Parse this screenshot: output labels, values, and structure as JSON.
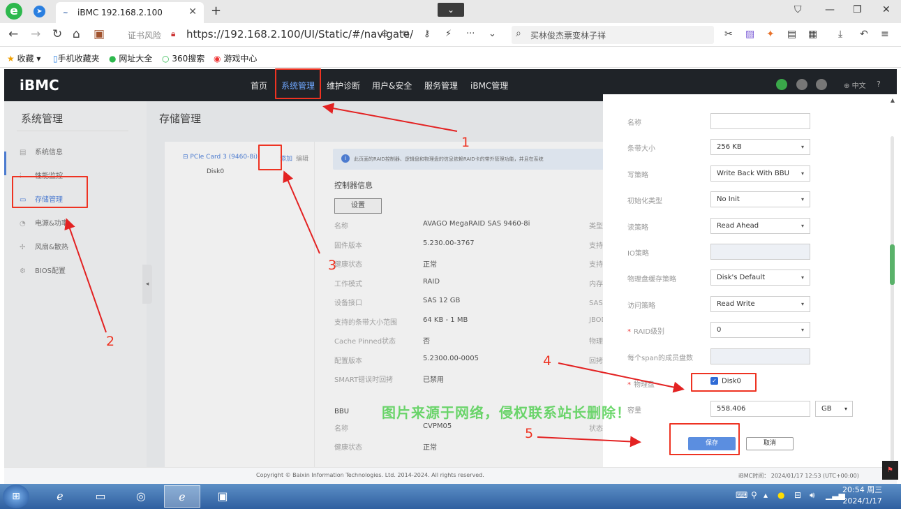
{
  "browser": {
    "tab_title": "iBMC 192.168.2.100",
    "favicon_text": "~",
    "cert_warning": "证书风险",
    "url": "https://192.168.2.100/UI/Static/#/navigate/",
    "search_text": "买林俊杰票变林子祥",
    "bookmarks": [
      "收藏",
      "手机收藏夹",
      "网址大全",
      "360搜索",
      "游戏中心"
    ]
  },
  "app": {
    "brand": "iBMC",
    "menu": [
      "首页",
      "系统管理",
      "维护诊断",
      "用户&安全",
      "服务管理",
      "iBMC管理"
    ],
    "lang": "中文"
  },
  "sidebar": {
    "title": "系统管理",
    "items": [
      {
        "label": "系统信息",
        "icon": "info-icon"
      },
      {
        "label": "性能监控",
        "icon": "chart-icon"
      },
      {
        "label": "存储管理",
        "icon": "storage-icon"
      },
      {
        "label": "电源&功率",
        "icon": "power-icon"
      },
      {
        "label": "风扇&散热",
        "icon": "fan-icon"
      },
      {
        "label": "BIOS配置",
        "icon": "gear-icon"
      }
    ]
  },
  "content": {
    "title": "存储管理",
    "tree_card": "PCIe Card 3 (9460-8i)",
    "tree_disk": "Disk0",
    "add": "添加",
    "edit": "编辑",
    "info_notice": "此页面的RAID控制器、逻辑盘和物理盘的信息依赖RAID卡的带外管理功能，并且在系统",
    "controller_title": "控制器信息",
    "settings_button": "设置",
    "controller": [
      {
        "k": "名称",
        "v": "AVAGO MegaRAID SAS 9460-8i",
        "r": "类型"
      },
      {
        "k": "固件版本",
        "v": "5.230.00-3767",
        "r": "支持"
      },
      {
        "k": "健康状态",
        "v": "正常",
        "r": "支持"
      },
      {
        "k": "工作模式",
        "v": "RAID",
        "r": "内存"
      },
      {
        "k": "设备接口",
        "v": "SAS 12 GB",
        "r": "SAS地"
      },
      {
        "k": "支持的条带大小范围",
        "v": "64 KB - 1 MB",
        "r": "JBOD"
      },
      {
        "k": "Cache Pinned状态",
        "v": "否",
        "r": "物理盘"
      },
      {
        "k": "配置版本",
        "v": "5.2300.00-0005",
        "r": "回拷"
      },
      {
        "k": "SMART错误时回拷",
        "v": "已禁用",
        "r": ""
      }
    ],
    "bbu_title": "BBU",
    "bbu": [
      {
        "k": "名称",
        "v": "CVPM05",
        "r": "状态"
      },
      {
        "k": "健康状态",
        "v": "正常",
        "r": ""
      }
    ]
  },
  "drawer": {
    "fields": [
      {
        "label": "名称",
        "value": "",
        "type": "input",
        "required": false
      },
      {
        "label": "条带大小",
        "value": "256 KB",
        "type": "select",
        "required": false
      },
      {
        "label": "写策略",
        "value": "Write Back With BBU",
        "type": "select",
        "required": false
      },
      {
        "label": "初始化类型",
        "value": "No Init",
        "type": "select",
        "required": false
      },
      {
        "label": "读策略",
        "value": "Read Ahead",
        "type": "select",
        "required": false
      },
      {
        "label": "IO策略",
        "value": "",
        "type": "disabled",
        "required": false
      },
      {
        "label": "物理盘缓存策略",
        "value": "Disk's Default",
        "type": "select",
        "required": false
      },
      {
        "label": "访问策略",
        "value": "Read Write",
        "type": "select",
        "required": false
      },
      {
        "label": "RAID级别",
        "value": "0",
        "type": "select",
        "required": true
      },
      {
        "label": "每个span的成员盘数",
        "value": "",
        "type": "disabled",
        "required": false
      }
    ],
    "physical_disk_label": "物理盘",
    "physical_disk": "Disk0",
    "capacity_label": "容量",
    "capacity": "558.406",
    "capacity_unit": "GB",
    "save": "保存",
    "cancel": "取消"
  },
  "footer": {
    "copyright": "Copyright © Baixin Information Technologies. Ltd. 2014-2024. All rights reserved.",
    "time": "iBMC时间：  2024/01/17 12:53 (UTC+00:00)"
  },
  "annotations": {
    "n1": "1",
    "n2": "2",
    "n3": "3",
    "n4": "4",
    "n5": "5",
    "color": "#e32222"
  },
  "watermark": "图片来源于网络，侵权联系站长删除！",
  "taskbar": {
    "clock_time": "20:54 周三",
    "clock_date": "2024/1/17"
  }
}
